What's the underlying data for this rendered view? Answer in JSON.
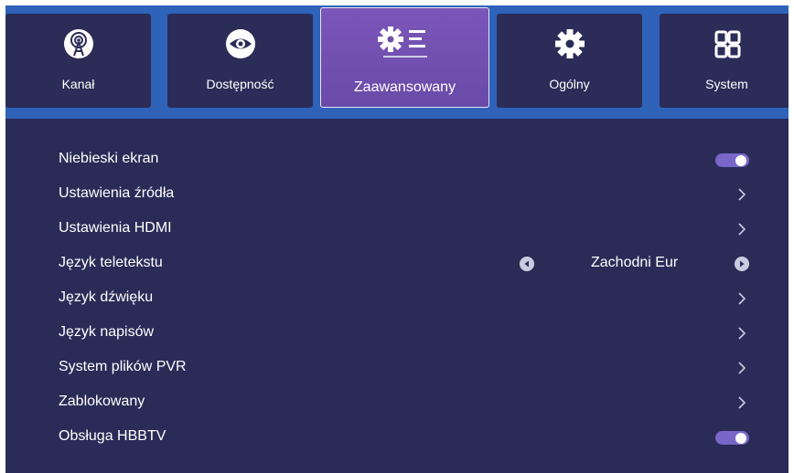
{
  "tabs": [
    {
      "label": "Kanał",
      "icon": "antenna-icon"
    },
    {
      "label": "Dostępność",
      "icon": "eye-icon"
    },
    {
      "label": "Zaawansowany",
      "icon": "advanced-settings-icon"
    },
    {
      "label": "Ogólny",
      "icon": "gear-icon"
    },
    {
      "label": "System",
      "icon": "system-grid-icon"
    }
  ],
  "active_tab": "Zaawansowany",
  "settings": [
    {
      "label": "Niebieski ekran",
      "control": "toggle",
      "state": "on"
    },
    {
      "label": "Ustawienia źródła",
      "control": "chevron"
    },
    {
      "label": "Ustawienia HDMI",
      "control": "chevron"
    },
    {
      "label": "Język teletekstu",
      "control": "selector",
      "value": "Zachodni Eur"
    },
    {
      "label": "Język dźwięku",
      "control": "chevron"
    },
    {
      "label": "Język napisów",
      "control": "chevron"
    },
    {
      "label": "System plików PVR",
      "control": "chevron"
    },
    {
      "label": "Zablokowany",
      "control": "chevron"
    },
    {
      "label": "Obsługa HBBTV",
      "control": "toggle",
      "state": "on"
    }
  ],
  "colors": {
    "topbar": "#2e63b9",
    "background": "#2b2b58",
    "active_tab": "#7a56b8",
    "toggle_on": "#7866c8"
  }
}
